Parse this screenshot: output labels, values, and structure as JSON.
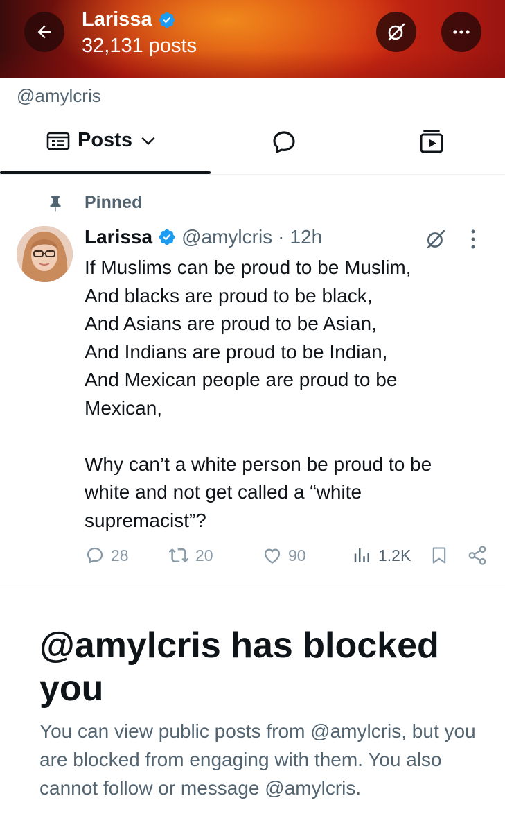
{
  "header": {
    "name": "Larissa",
    "post_count": "32,131 posts",
    "colors": {
      "banner_orange": "#f08a1c",
      "banner_red": "#c41e12",
      "button_bg": "#2a0808"
    }
  },
  "profile": {
    "handle": "@amylcris"
  },
  "tabs": [
    {
      "label": "Posts",
      "icon": "posts-list-icon",
      "active": true
    },
    {
      "label": "",
      "icon": "replies-bubble-icon",
      "active": false
    },
    {
      "label": "",
      "icon": "media-play-icon",
      "active": false
    }
  ],
  "pinned_label": "Pinned",
  "tweet": {
    "name": "Larissa",
    "handle": "@amylcris",
    "time": "12h",
    "lines": [
      "If Muslims can be proud to be Muslim,",
      "And blacks are proud to be black,",
      "And Asians are proud to be Asian,",
      "And Indians are proud to be Indian,",
      "And Mexican people are proud to be",
      "Mexican,",
      "Why can’t a white person be proud to be",
      "white and not get called a “white",
      "supremacist”?"
    ],
    "stats": {
      "replies": "28",
      "reposts": "20",
      "likes": "90",
      "views": "1.2K"
    }
  },
  "blocked": {
    "title": "@amylcris has blocked you",
    "description": "You can view public posts from @amylcris, but you are blocked from engaging with them. You also cannot follow or message @amylcris."
  },
  "colors": {
    "verified_blue": "#1d9bf0",
    "secondary_text": "#536471",
    "primary_text": "#0f1419",
    "muted_icon": "#8899a6"
  }
}
